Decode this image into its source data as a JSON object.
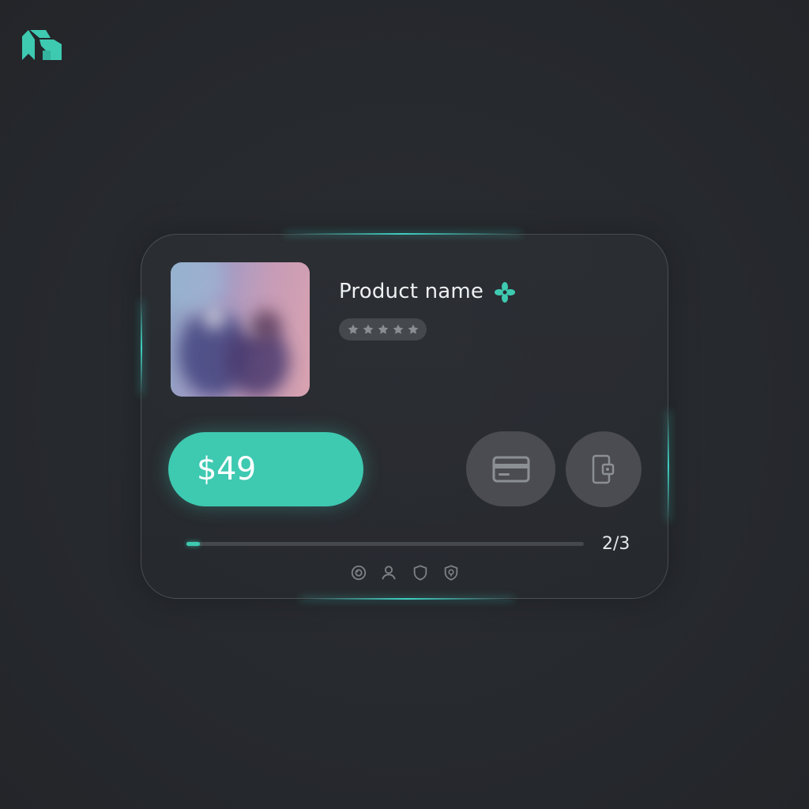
{
  "brand": {
    "logo_icon": "brand-logo-icon",
    "accent_color": "#3ec9b1"
  },
  "product": {
    "name": "Product name",
    "badge_icon": "sparkle-icon",
    "image_icon": "product-photo",
    "rating": {
      "stars_total": 5,
      "stars_filled": 0
    }
  },
  "actions": {
    "price_label": "$49",
    "card_payment_icon": "credit-card-icon",
    "wallet_payment_icon": "wallet-icon"
  },
  "progress": {
    "fraction": 0.033,
    "step_text": "2/3"
  },
  "footer": {
    "icons": [
      "badge-icon",
      "user-icon",
      "shield-icon",
      "security-shield-icon"
    ]
  }
}
